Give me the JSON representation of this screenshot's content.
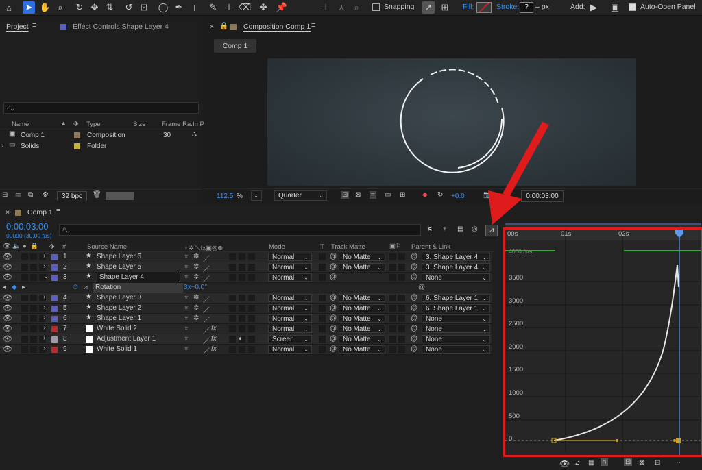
{
  "colors": {
    "accent": "#2d6fe0",
    "highlight_red": "#e01b1b",
    "layer_blue": "#5a5fc0",
    "layer_red": "#b03030",
    "layer_white": "#ffffff",
    "layer_gray": "#9a9aa8",
    "timecode_blue": "#3b8fef",
    "graph_curve": "#e6e6e6",
    "work_area_green": "#2fae2f",
    "playhead": "#5b9bef"
  },
  "toolbar": {
    "snapping_label": "Snapping",
    "fill_label": "Fill:",
    "stroke_label": "Stroke:",
    "stroke_value": "?",
    "stroke_unit": "– px",
    "add_label": "Add:",
    "auto_open_label": "Auto-Open Panel"
  },
  "project_panel": {
    "tab_label": "Project",
    "effect_controls_label": "Effect Controls Shape Layer 4",
    "search_placeholder": "",
    "columns": [
      "Name",
      "Type",
      "Size",
      "Frame Ra...",
      "In P"
    ],
    "items": [
      {
        "name": "Comp 1",
        "type": "Composition",
        "size": "",
        "frame_rate": "30",
        "color": "#8a7a5a"
      },
      {
        "name": "Solids",
        "type": "Folder",
        "size": "",
        "frame_rate": "",
        "color": "#c8b040"
      }
    ],
    "bit_depth": "32 bpc"
  },
  "comp_panel": {
    "tab_label": "Composition Comp 1",
    "comp_tab": "Comp 1",
    "zoom": "112.5",
    "zoom_unit": "%",
    "resolution": "Quarter",
    "exposure": "+0.0",
    "timecode": "0:00:03:00"
  },
  "timeline": {
    "tab_label": "Comp 1",
    "timecode": "0:00:03:00",
    "frame_info": "00090 (30.00 fps)",
    "columns": {
      "num": "#",
      "source_name": "Source Name",
      "mode": "Mode",
      "t": "T",
      "track_matte": "Track Matte",
      "parent": "Parent & Link"
    },
    "layers": [
      {
        "num": "1",
        "name": "Shape Layer 6",
        "color": "#5a5fc0",
        "mode": "Normal",
        "matte": "No Matte",
        "parent": "3. Shape Layer 4",
        "type": "shape"
      },
      {
        "num": "2",
        "name": "Shape Layer 5",
        "color": "#5a5fc0",
        "mode": "Normal",
        "matte": "No Matte",
        "parent": "3. Shape Layer 4",
        "type": "shape"
      },
      {
        "num": "3",
        "name": "Shape Layer 4",
        "color": "#5a5fc0",
        "mode": "Normal",
        "matte": "",
        "parent": "None",
        "type": "shape",
        "selected": true
      },
      {
        "num": "4",
        "name": "Shape Layer 3",
        "color": "#5a5fc0",
        "mode": "Normal",
        "matte": "No Matte",
        "parent": "6. Shape Layer 1",
        "type": "shape"
      },
      {
        "num": "5",
        "name": "Shape Layer 2",
        "color": "#5a5fc0",
        "mode": "Normal",
        "matte": "No Matte",
        "parent": "6. Shape Layer 1",
        "type": "shape"
      },
      {
        "num": "6",
        "name": "Shape Layer 1",
        "color": "#5a5fc0",
        "mode": "Normal",
        "matte": "No Matte",
        "parent": "None",
        "type": "shape"
      },
      {
        "num": "7",
        "name": "White Solid 2",
        "color": "#b03030",
        "mode": "Normal",
        "matte": "No Matte",
        "parent": "None",
        "type": "solid"
      },
      {
        "num": "8",
        "name": "Adjustment Layer 1",
        "color": "#9a9aa8",
        "mode": "Screen",
        "matte": "No Matte",
        "parent": "None",
        "type": "adjust"
      },
      {
        "num": "9",
        "name": "White Solid 1",
        "color": "#b03030",
        "mode": "Normal",
        "matte": "No Matte",
        "parent": "None",
        "type": "solid"
      }
    ],
    "property": {
      "name": "Rotation",
      "value": "3x+0.0°"
    }
  },
  "graph_editor": {
    "ruler": [
      "00s",
      "01s",
      "02s"
    ],
    "y_ticks": [
      "3500",
      "3000",
      "2500",
      "2000",
      "1500",
      "1000",
      "500",
      "0"
    ],
    "top_label": "4000 /sec"
  },
  "bottom_bar": {
    "icons": [
      "eye-icon",
      "graph-icon",
      "snap-icon",
      "fit-icon",
      "keyframe-icon",
      "easy-ease-icon"
    ]
  }
}
